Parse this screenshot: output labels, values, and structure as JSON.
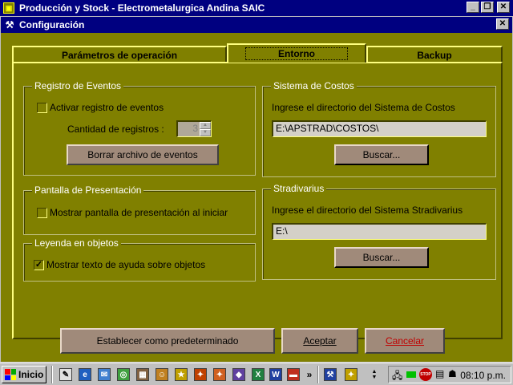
{
  "app": {
    "title": "Producción y Stock - Electrometalurgica Andina SAIC"
  },
  "dialog": {
    "title": "Configuración"
  },
  "tabs": [
    {
      "label": "Parámetros de operación",
      "active": false
    },
    {
      "label": "Entorno",
      "active": true
    },
    {
      "label": "Backup",
      "active": false
    }
  ],
  "registro": {
    "legend": "Registro de Eventos",
    "activar_label": "Activar registro de eventos",
    "activar_checked": false,
    "cantidad_label": "Cantidad de registros :",
    "cantidad_value": "3",
    "borrar_button": "Borrar archivo de eventos"
  },
  "pantalla": {
    "legend": "Pantalla de Presentación",
    "mostrar_label": "Mostrar pantalla de presentación al iniciar",
    "mostrar_checked": false
  },
  "leyenda": {
    "legend": "Leyenda en objetos",
    "mostrar_label": "Mostrar texto de ayuda sobre objetos",
    "mostrar_checked": true
  },
  "costos": {
    "legend": "Sistema de Costos",
    "prompt": "Ingrese el directorio del Sistema de Costos",
    "path": "E:\\APSTRAD\\COSTOS\\",
    "buscar": "Buscar..."
  },
  "stradivarius": {
    "legend": "Stradivarius",
    "prompt": "Ingrese el directorio del Sistema Stradivarius",
    "path": "E:\\",
    "buscar": "Buscar..."
  },
  "footer": {
    "default_button": "Establecer como predeterminado",
    "accept_button": "Aceptar",
    "cancel_button": "Cancelar"
  },
  "taskbar": {
    "start_label": "Inicio",
    "chevron": "»",
    "clock": "08:10 p.m."
  },
  "colors": {
    "dialog_bg": "#808000",
    "titlebar": "#000080",
    "cancel_text": "#c00000"
  }
}
